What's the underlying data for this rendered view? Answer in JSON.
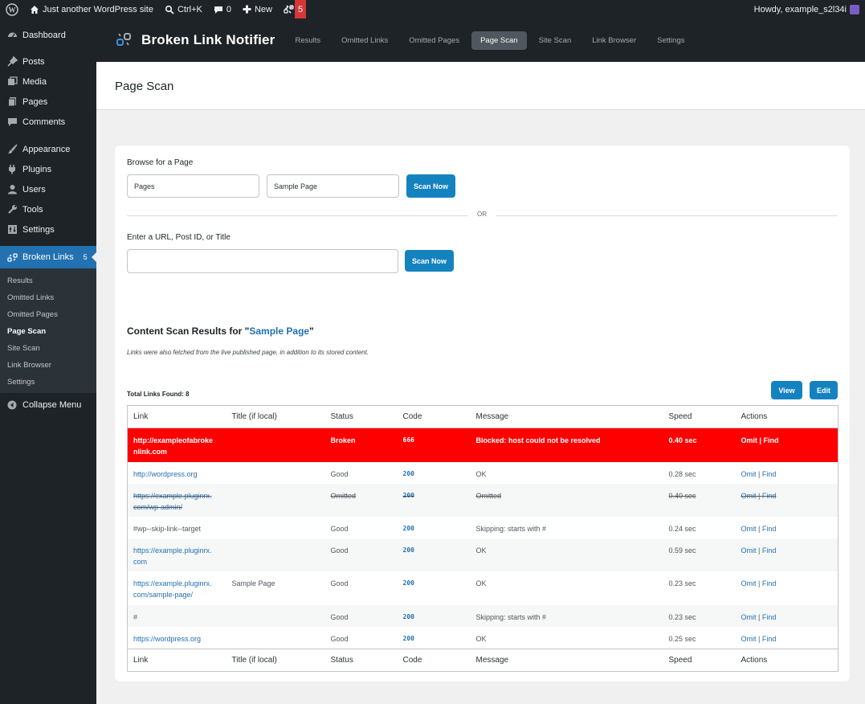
{
  "adminbar": {
    "site_name": "Just another WordPress site",
    "search_shortcut": "Ctrl+K",
    "comments_count": "0",
    "new_label": "New",
    "plugin_badge": "5",
    "howdy": "Howdy, example_s2l34i"
  },
  "menu": {
    "items": [
      {
        "label": "Dashboard",
        "icon": "dashboard-icon"
      },
      {
        "label": "Posts",
        "icon": "pin-icon"
      },
      {
        "label": "Media",
        "icon": "media-icon"
      },
      {
        "label": "Pages",
        "icon": "pages-icon"
      },
      {
        "label": "Comments",
        "icon": "comment-icon"
      },
      {
        "label": "Appearance",
        "icon": "brush-icon"
      },
      {
        "label": "Plugins",
        "icon": "plugin-icon"
      },
      {
        "label": "Users",
        "icon": "user-icon"
      },
      {
        "label": "Tools",
        "icon": "wrench-icon"
      },
      {
        "label": "Settings",
        "icon": "settings-icon"
      }
    ],
    "current": {
      "label": "Broken Links",
      "badge": "5"
    },
    "submenu": [
      "Results",
      "Omitted Links",
      "Omitted Pages",
      "Page Scan",
      "Site Scan",
      "Link Browser",
      "Settings"
    ],
    "collapse_label": "Collapse Menu"
  },
  "plugin": {
    "title": "Broken Link Notifier",
    "tabs": [
      "Results",
      "Omitted Links",
      "Omitted Pages",
      "Page Scan",
      "Site Scan",
      "Link Browser",
      "Settings"
    ],
    "active_tab": "Page Scan"
  },
  "page_title": "Page Scan",
  "browse": {
    "label": "Browse for a Page",
    "post_type": "Pages",
    "page": "Sample Page",
    "button": "Scan Now"
  },
  "or_label": "OR",
  "url_input": {
    "label": "Enter a URL, Post ID, or Title",
    "value": "",
    "button": "Scan Now"
  },
  "results": {
    "heading_prefix": "Content Scan Results for \"",
    "heading_link": "Sample Page",
    "heading_suffix": "\"",
    "note": "Links were also fetched from the live published page, in addition to its stored content.",
    "total": "Total Links Found: 8",
    "view_button": "View",
    "edit_button": "Edit",
    "columns": [
      "Link",
      "Title (if local)",
      "Status",
      "Code",
      "Message",
      "Speed",
      "Actions"
    ],
    "rows": [
      {
        "link": "http://exampleofabroke nlink.com",
        "title": "",
        "status": "Broken",
        "code": "666",
        "message": "Blocked: host could not be resolved",
        "speed": "0.40 sec",
        "omit": "Omit",
        "find": "Find"
      },
      {
        "link": "http://wordpress.org",
        "title": "",
        "status": "Good",
        "code": "200",
        "message": "OK",
        "speed": "0.28 sec",
        "omit": "Omit",
        "find": "Find"
      },
      {
        "link": "https://example.pluginrx. com/wp-admin/",
        "title": "",
        "status": "Omitted",
        "code": "200",
        "message": "Omitted",
        "speed": "0.40 sec",
        "omit": "Omit",
        "find": "Find"
      },
      {
        "link": "#wp--skip-link--target",
        "title": "",
        "status": "Good",
        "code": "200",
        "message": "Skipping: starts with #",
        "speed": "0.24 sec",
        "omit": "Omit",
        "find": "Find"
      },
      {
        "link": "https://example.pluginrx. com",
        "title": "",
        "status": "Good",
        "code": "200",
        "message": "OK",
        "speed": "0.59 sec",
        "omit": "Omit",
        "find": "Find"
      },
      {
        "link": "https://example.pluginrx. com/sample-page/",
        "title": "Sample Page",
        "status": "Good",
        "code": "200",
        "message": "OK",
        "speed": "0.23 sec",
        "omit": "Omit",
        "find": "Find"
      },
      {
        "link": "#",
        "title": "",
        "status": "Good",
        "code": "200",
        "message": "Skipping: starts with #",
        "speed": "0.23 sec",
        "omit": "Omit",
        "find": "Find"
      },
      {
        "link": "https://wordpress.org",
        "title": "",
        "status": "Good",
        "code": "200",
        "message": "OK",
        "speed": "0.25 sec",
        "omit": "Omit",
        "find": "Find"
      }
    ]
  },
  "colors": {
    "broken": "#ff0000",
    "accent": "#2271b1",
    "button": "#1582c0"
  }
}
